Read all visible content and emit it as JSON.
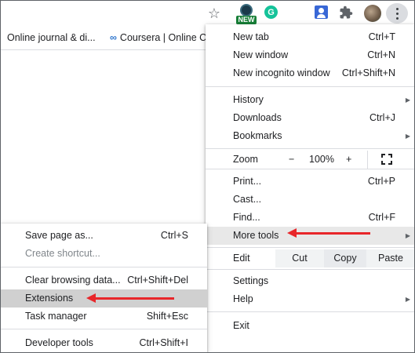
{
  "toolbar": {
    "new_badge": "NEW",
    "grammarly_letter": "G",
    "star_glyph": "☆"
  },
  "bookmarks": [
    {
      "label": "Online journal & di..."
    },
    {
      "label": "Coursera | Online C"
    }
  ],
  "main_menu": {
    "new_tab": {
      "label": "New tab",
      "shortcut": "Ctrl+T"
    },
    "new_window": {
      "label": "New window",
      "shortcut": "Ctrl+N"
    },
    "new_incognito": {
      "label": "New incognito window",
      "shortcut": "Ctrl+Shift+N"
    },
    "history": {
      "label": "History"
    },
    "downloads": {
      "label": "Downloads",
      "shortcut": "Ctrl+J"
    },
    "bookmarks": {
      "label": "Bookmarks"
    },
    "zoom": {
      "label": "Zoom",
      "minus": "−",
      "value": "100%",
      "plus": "+"
    },
    "print": {
      "label": "Print...",
      "shortcut": "Ctrl+P"
    },
    "cast": {
      "label": "Cast..."
    },
    "find": {
      "label": "Find...",
      "shortcut": "Ctrl+F"
    },
    "more_tools": {
      "label": "More tools"
    },
    "edit": {
      "label": "Edit",
      "cut": "Cut",
      "copy": "Copy",
      "paste": "Paste"
    },
    "settings": {
      "label": "Settings"
    },
    "help": {
      "label": "Help"
    },
    "exit": {
      "label": "Exit"
    }
  },
  "sub_menu": {
    "save_page": {
      "label": "Save page as...",
      "shortcut": "Ctrl+S"
    },
    "create_shortcut": {
      "label": "Create shortcut..."
    },
    "clear_data": {
      "label": "Clear browsing data...",
      "shortcut": "Ctrl+Shift+Del"
    },
    "extensions": {
      "label": "Extensions"
    },
    "task_manager": {
      "label": "Task manager",
      "shortcut": "Shift+Esc"
    },
    "developer_tools": {
      "label": "Developer tools",
      "shortcut": "Ctrl+Shift+I"
    }
  },
  "colors": {
    "annotation_arrow": "#e8262a",
    "highlight": "#e8e8e8",
    "grammarly": "#15c39a",
    "new_badge": "#188038"
  }
}
